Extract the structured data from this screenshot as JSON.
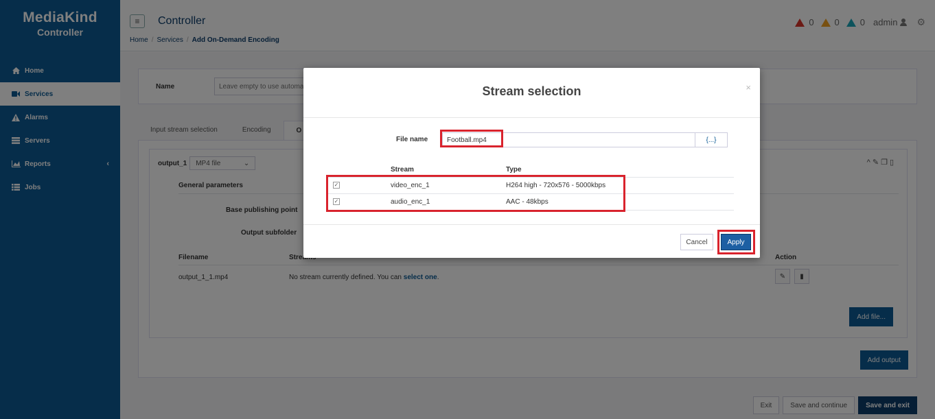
{
  "brand": {
    "logo": "MediaKind",
    "subtitle": "Controller"
  },
  "sidebar": {
    "items": [
      {
        "label": "Home",
        "icon": "home-icon"
      },
      {
        "label": "Services",
        "icon": "video-camera-icon",
        "active": true
      },
      {
        "label": "Alarms",
        "icon": "warning-icon"
      },
      {
        "label": "Servers",
        "icon": "server-icon"
      },
      {
        "label": "Reports",
        "icon": "area-chart-icon",
        "chevron": "‹"
      },
      {
        "label": "Jobs",
        "icon": "list-icon"
      }
    ]
  },
  "header": {
    "menu_icon": "≡",
    "title": "Controller",
    "breadcrumb": [
      "Home",
      "Services",
      "Add On-Demand Encoding"
    ],
    "alarms": {
      "critical": "0",
      "major": "0",
      "minor": "0"
    },
    "alarm_colors": {
      "critical": "#d9342b",
      "major": "#f0a020",
      "minor": "#1ba7b8"
    },
    "user": "admin",
    "settings_icon": "⚙"
  },
  "form": {
    "name_label": "Name",
    "name_placeholder": "Leave empty to use automa",
    "tabs": [
      "Input stream selection",
      "Encoding",
      "O"
    ],
    "output": {
      "title": "output_1",
      "format": "MP4 file",
      "general_parameters": "General parameters",
      "base_publishing_point": "Base publishing point",
      "output_subfolder": "Output subfolder",
      "table": {
        "headers": {
          "filename": "Filename",
          "streams": "Streams",
          "action": "Action"
        },
        "rows": [
          {
            "filename": "output_1_1.mp4",
            "streams_text": "No stream currently defined. You can ",
            "streams_link": "select one",
            "streams_suffix": "."
          }
        ]
      },
      "add_file": "Add file..."
    },
    "add_output": "Add output",
    "footer": {
      "exit": "Exit",
      "save_continue": "Save and continue",
      "save_exit": "Save and exit"
    }
  },
  "modal": {
    "title": "Stream selection",
    "close": "×",
    "file_name_label": "File name",
    "file_name_value": "Football.mp4",
    "macro_button": "{...}",
    "headers": {
      "stream": "Stream",
      "type": "Type"
    },
    "streams": [
      {
        "name": "video_enc_1",
        "type": "H264 high - 720x576 - 5000kbps",
        "checked": true
      },
      {
        "name": "audio_enc_1",
        "type": "AAC - 48kbps",
        "checked": true
      }
    ],
    "cancel": "Cancel",
    "apply": "Apply",
    "highlight_color": "#d9232d"
  }
}
